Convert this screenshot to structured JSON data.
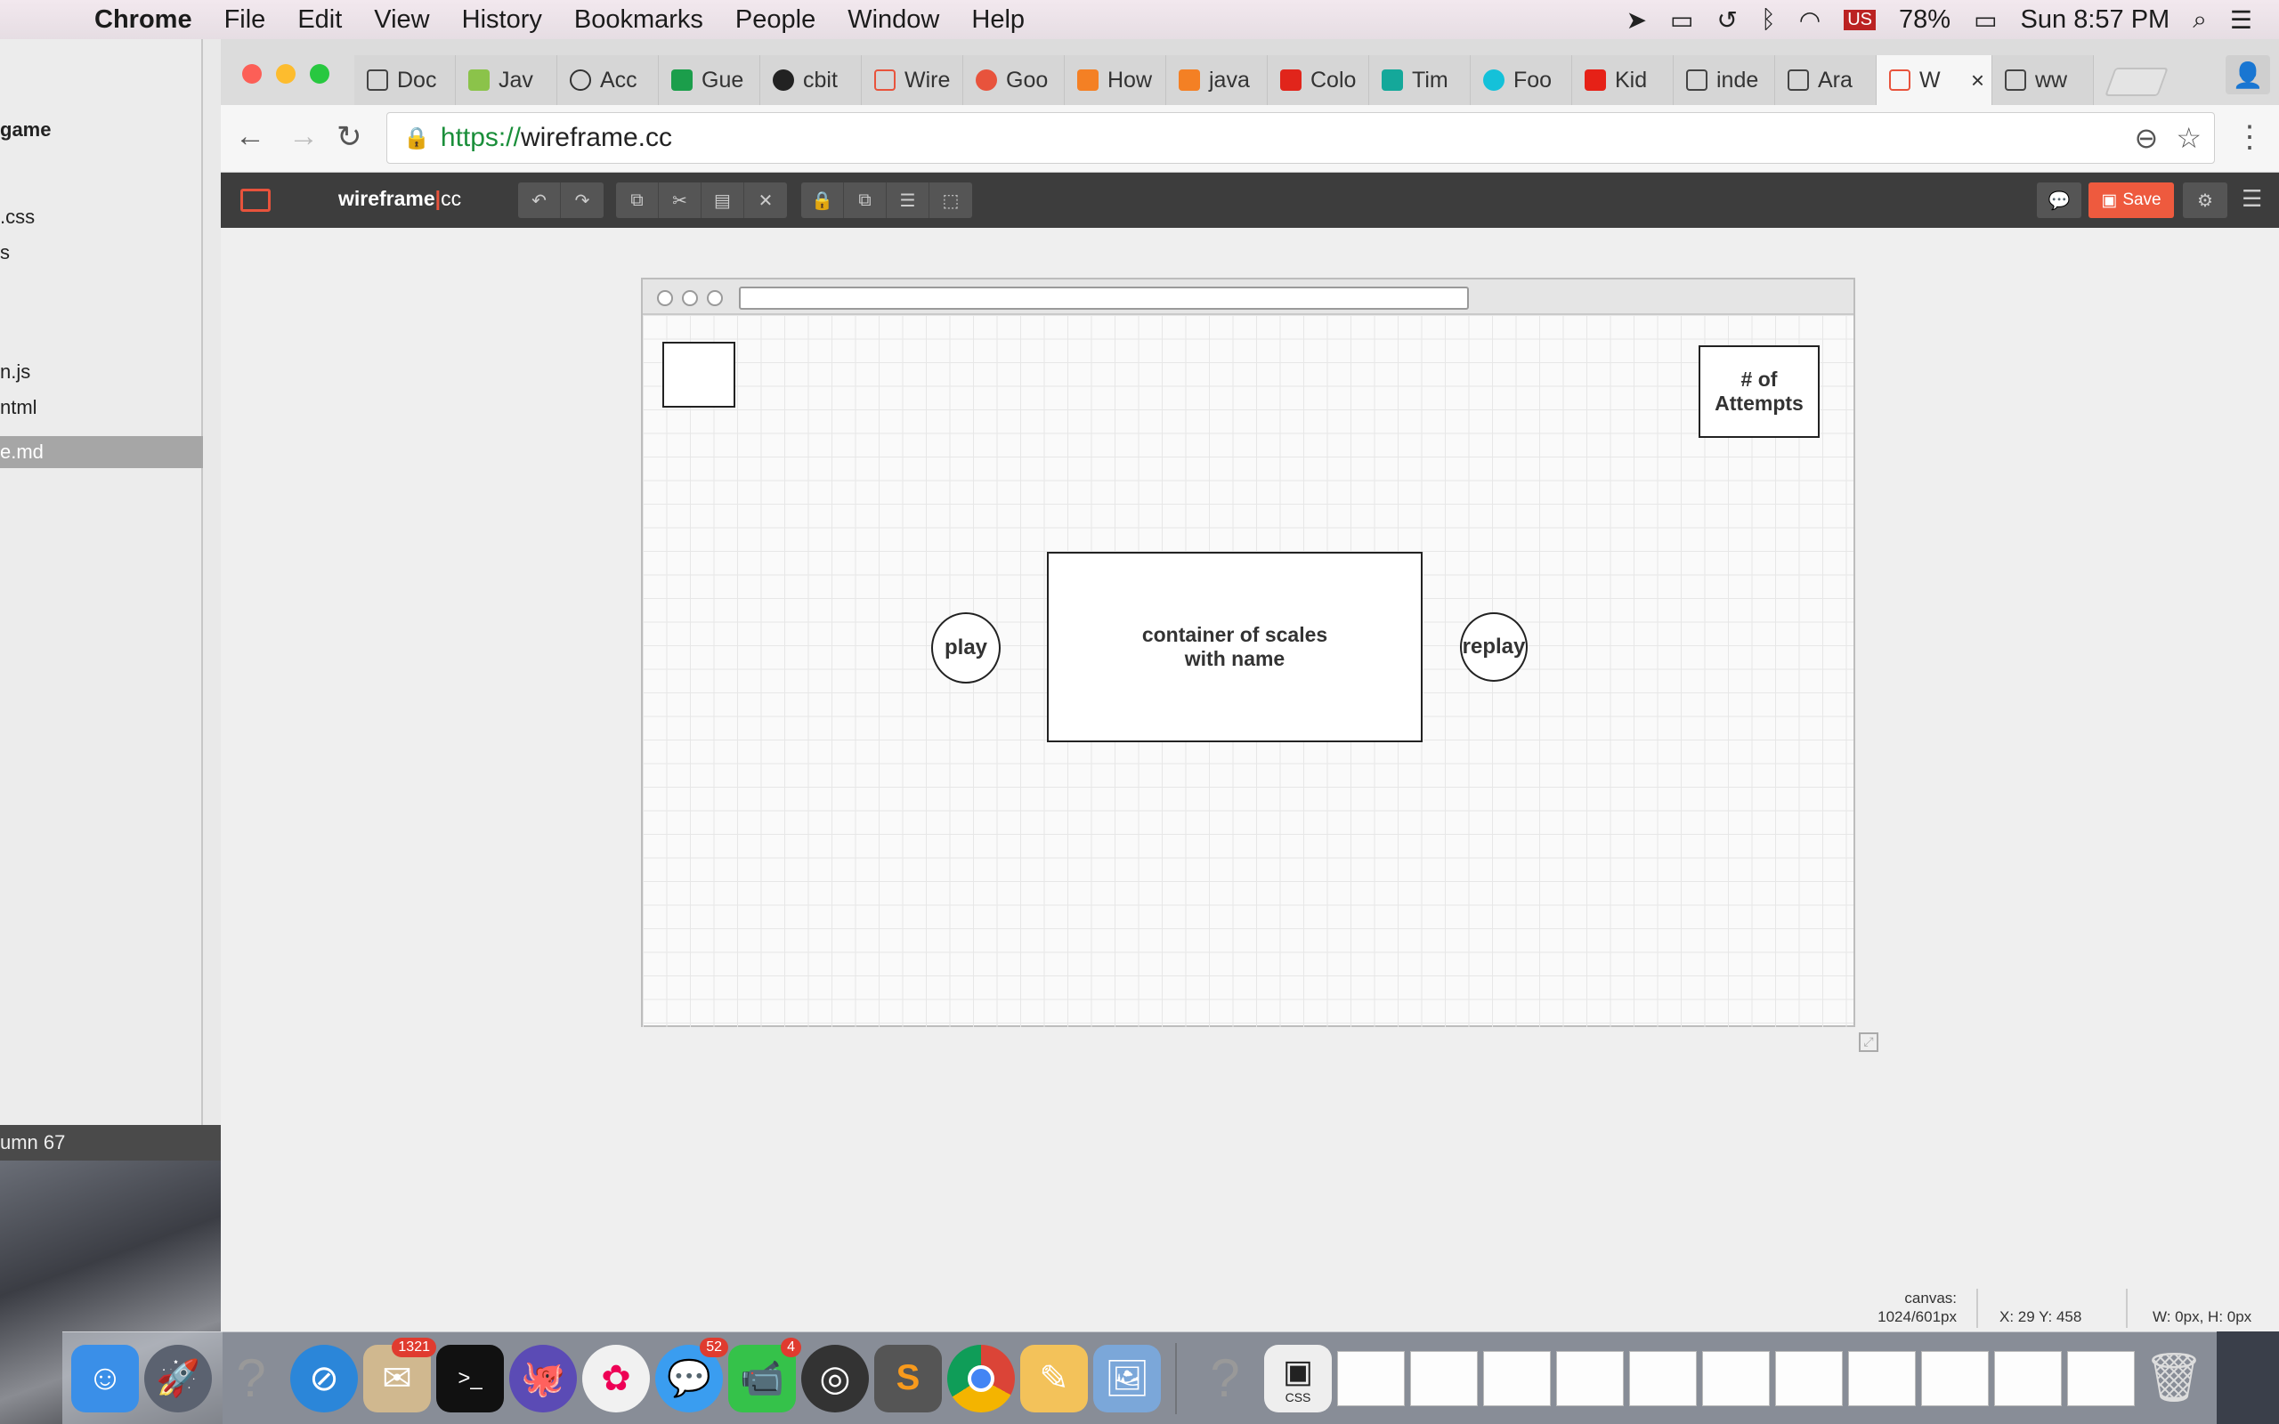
{
  "menubar": {
    "app": "Chrome",
    "items": [
      "File",
      "Edit",
      "View",
      "History",
      "Bookmarks",
      "People",
      "Window",
      "Help"
    ],
    "battery": "78%",
    "clock": "Sun 8:57 PM"
  },
  "editor_window": {
    "files": [
      "game",
      ".css",
      "s",
      "n.js",
      "ntml",
      "e.md"
    ],
    "status": "umn 67"
  },
  "chrome": {
    "tabs": [
      {
        "label": "Doc",
        "icon": "document-icon"
      },
      {
        "label": "Jav",
        "icon": "w3schools-icon"
      },
      {
        "label": "Acc",
        "icon": "graph-icon"
      },
      {
        "label": "Gue",
        "icon": "trello-icon"
      },
      {
        "label": "cbit",
        "icon": "github-icon"
      },
      {
        "label": "Wire",
        "icon": "wireframe-icon"
      },
      {
        "label": "Goo",
        "icon": "f-icon"
      },
      {
        "label": "How",
        "icon": "stackoverflow-icon"
      },
      {
        "label": "java",
        "icon": "stackoverflow-icon"
      },
      {
        "label": "Colo",
        "icon": "adobe-icon"
      },
      {
        "label": "Tim",
        "icon": "teal-square-icon"
      },
      {
        "label": "Foo",
        "icon": "c-icon"
      },
      {
        "label": "Kid",
        "icon": "youtube-icon"
      },
      {
        "label": "inde",
        "icon": "document-icon"
      },
      {
        "label": "Ara",
        "icon": "document-icon"
      },
      {
        "label": "W",
        "icon": "wireframe-icon",
        "active": true
      },
      {
        "label": "ww",
        "icon": "document-icon"
      }
    ],
    "url_scheme": "https://",
    "url_host": "wireframe.cc"
  },
  "app": {
    "brand": "wireframe",
    "brand_suffix": "cc",
    "save_label": "Save"
  },
  "canvas": {
    "shapes": {
      "attempts": "# of Attempts",
      "play": "play",
      "container": "container of scales with name",
      "replay": "replay"
    },
    "status": {
      "canvas_label": "canvas:",
      "canvas_size": "1024/601px",
      "coords": "X: 29 Y: 458",
      "dims": "W: 0px, H: 0px"
    }
  },
  "dock": {
    "badges": {
      "mail": "1321",
      "messages": "52",
      "facetime": "4"
    },
    "stack_label": "CSS"
  }
}
